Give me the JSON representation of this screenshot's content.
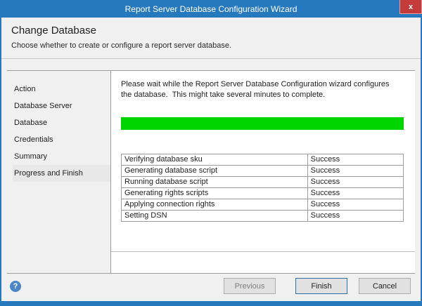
{
  "window": {
    "title": "Report Server Database Configuration Wizard",
    "close_label": "x"
  },
  "header": {
    "title": "Change Database",
    "subtitle": "Choose whether to create or configure a report server database."
  },
  "sidebar": {
    "items": [
      {
        "label": "Action",
        "active": false
      },
      {
        "label": "Database Server",
        "active": false
      },
      {
        "label": "Database",
        "active": false
      },
      {
        "label": "Credentials",
        "active": false
      },
      {
        "label": "Summary",
        "active": false
      },
      {
        "label": "Progress and Finish",
        "active": true
      }
    ]
  },
  "main": {
    "instruction": "Please wait while the Report Server Database Configuration wizard configures the database.  This might take several minutes to complete.",
    "progress_percent": 100,
    "tasks": {
      "rows": [
        {
          "task": "Verifying database sku",
          "status": "Success"
        },
        {
          "task": "Generating database script",
          "status": "Success"
        },
        {
          "task": "Running database script",
          "status": "Success"
        },
        {
          "task": "Generating rights scripts",
          "status": "Success"
        },
        {
          "task": "Applying connection rights",
          "status": "Success"
        },
        {
          "task": "Setting DSN",
          "status": "Success"
        }
      ]
    }
  },
  "footer": {
    "help_label": "?",
    "buttons": {
      "previous": "Previous",
      "finish": "Finish",
      "cancel": "Cancel"
    }
  },
  "colors": {
    "titlebar": "#2779be",
    "close_button": "#c33b3b",
    "progress_green": "#00d500",
    "panel_background": "#f0f0f0",
    "content_background": "#ffffff"
  }
}
